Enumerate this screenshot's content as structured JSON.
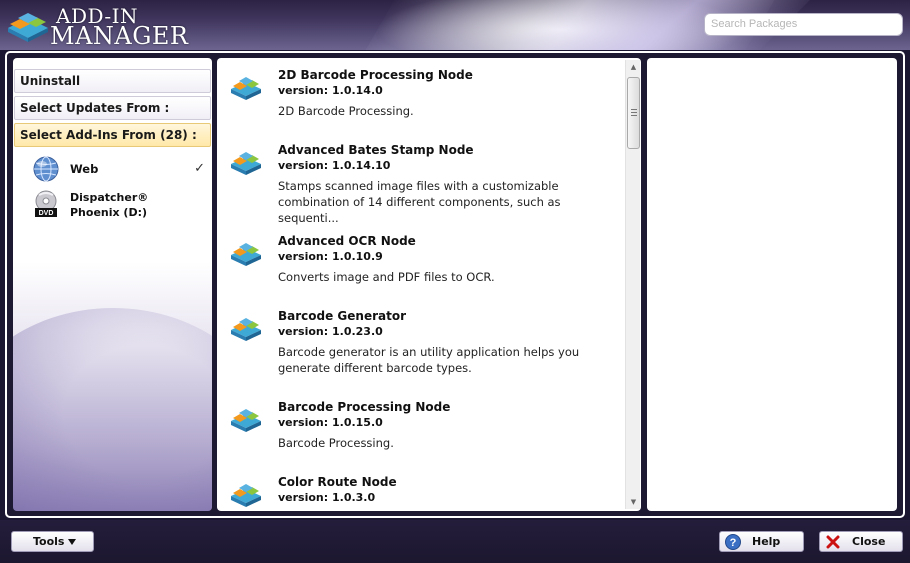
{
  "app": {
    "title_line1": "ADD-IN",
    "title_line2": "MANAGER"
  },
  "search": {
    "placeholder": "Search Packages"
  },
  "sidebar": {
    "uninstall_label": "Uninstall",
    "updates_label": "Select Updates From :",
    "addins_label": "Select Add-Ins From (28) :",
    "sources": [
      {
        "label": "Web",
        "icon": "globe-icon",
        "selected": true,
        "check": "✓"
      },
      {
        "label_line1": "Dispatcher®",
        "label_line2": "Phoenix (D:)",
        "icon": "dvd-icon",
        "selected": false
      }
    ]
  },
  "packages": [
    {
      "name": "2D Barcode Processing Node",
      "version": "version: 1.0.14.0",
      "description": "2D Barcode Processing."
    },
    {
      "name": "Advanced Bates Stamp Node",
      "version": "version: 1.0.14.10",
      "description": "Stamps scanned image files with a customizable combination of 14 different components, such as sequenti..."
    },
    {
      "name": "Advanced OCR Node",
      "version": "version: 1.0.10.9",
      "description": "Converts image and PDF files to OCR."
    },
    {
      "name": "Barcode Generator",
      "version": "version: 1.0.23.0",
      "description": "Barcode generator is an utility application helps you generate different barcode types."
    },
    {
      "name": "Barcode Processing Node",
      "version": "version: 1.0.15.0",
      "description": "Barcode Processing."
    },
    {
      "name": "Color Route Node",
      "version": "version: 1.0.3.0",
      "description": ""
    }
  ],
  "footer": {
    "tools_label": "Tools",
    "help_label": "Help",
    "close_label": "Close"
  },
  "colors": {
    "header_dark": "#2c2344",
    "selected_section": "#ffe8a8",
    "close_x": "#cc1111",
    "help_blue": "#3a6fc4"
  }
}
